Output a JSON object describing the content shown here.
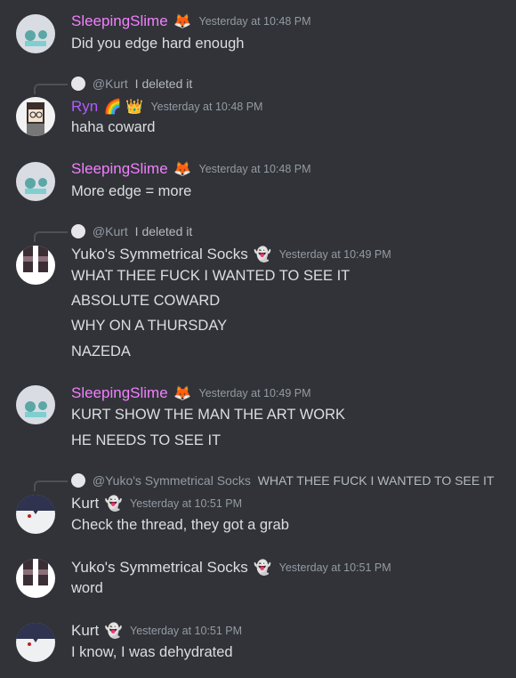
{
  "colors": {
    "background": "#313338",
    "text": "#dbdee1",
    "muted": "#949ba4",
    "slime_name": "#f47fff",
    "ryn_name": "#b05bff",
    "default_name": "#dbdee1"
  },
  "messages": [
    {
      "user": "SleepingSlime",
      "emoji": "🦊",
      "time": "Yesterday at 10:48 PM",
      "lines": [
        "Did you edge hard enough"
      ]
    },
    {
      "reply": {
        "to": "@Kurt",
        "text": "I deleted it"
      },
      "user": "Ryn",
      "emoji": "🌈 👑",
      "time": "Yesterday at 10:48 PM",
      "lines": [
        "haha coward"
      ]
    },
    {
      "user": "SleepingSlime",
      "emoji": "🦊",
      "time": "Yesterday at 10:48 PM",
      "lines": [
        "More edge = more"
      ]
    },
    {
      "reply": {
        "to": "@Kurt",
        "text": "I deleted it"
      },
      "user": "Yuko's Symmetrical Socks",
      "emoji": "👻",
      "time": "Yesterday at 10:49 PM",
      "lines": [
        "WHAT THEE FUCK I WANTED TO SEE IT",
        "ABSOLUTE COWARD",
        "WHY ON A THURSDAY",
        "NAZEDA"
      ]
    },
    {
      "user": "SleepingSlime",
      "emoji": "🦊",
      "time": "Yesterday at 10:49 PM",
      "lines": [
        "KURT SHOW THE MAN THE ART WORK",
        "HE NEEDS TO SEE IT"
      ]
    },
    {
      "reply": {
        "to": "@Yuko's Symmetrical Socks",
        "text": "WHAT THEE FUCK I WANTED TO SEE IT"
      },
      "user": "Kurt",
      "emoji": "👻",
      "time": "Yesterday at 10:51 PM",
      "lines": [
        "Check the thread, they got a grab"
      ]
    },
    {
      "user": "Yuko's Symmetrical Socks",
      "emoji": "👻",
      "time": "Yesterday at 10:51 PM",
      "lines": [
        "word"
      ]
    },
    {
      "user": "Kurt",
      "emoji": "👻",
      "time": "Yesterday at 10:51 PM",
      "lines": [
        "I know, I was dehydrated"
      ]
    }
  ]
}
